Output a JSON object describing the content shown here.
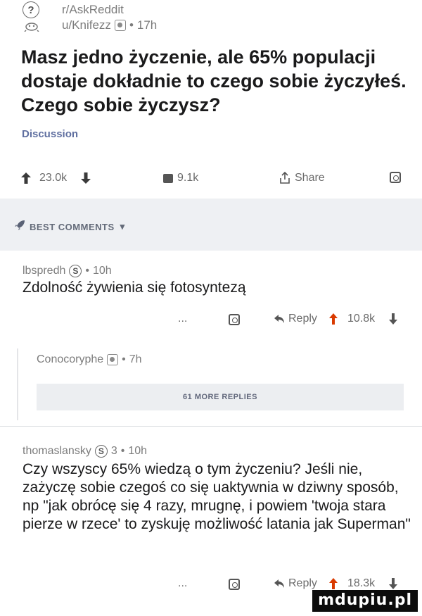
{
  "post": {
    "subreddit": "r/AskReddit",
    "author": "u/Knifezz",
    "age": "17h",
    "title": "Masz jedno życzenie, ale 65% populacji dostaje dokładnie to czego sobie życzyłeś. Czego sobie życzysz?",
    "flair": "Discussion",
    "upvotes": "23.0k",
    "comments": "9.1k",
    "share_label": "Share"
  },
  "best_comments_label": "BEST COMMENTS",
  "comments": [
    {
      "author": "lbspredh",
      "age": "10h",
      "body": "Zdolność żywienia się fotosyntezą",
      "reply_label": "Reply",
      "score": "10.8k"
    },
    {
      "author": "Conocoryphe",
      "age": "7h"
    },
    {
      "author": "thomaslansky",
      "badge_count": "3",
      "age": "10h",
      "body": "Czy wszyscy 65% wiedzą o tym życzeniu? Jeśli nie, zażyczę sobie czegoś co się uaktywnia w dziwny sposób, np \"jak obrócę się 4 razy, mrugnę, i powiem 'twoja stara pierze w rzece' to zyskuję możliwość latania jak Superman\"",
      "reply_label": "Reply",
      "score": "18.3k"
    }
  ],
  "more_replies_label": "61 MORE REPLIES",
  "ellipsis": "...",
  "watermark": "mdupiu.pl",
  "colors": {
    "upvote": "#d93a00",
    "text": "#1a1a1b",
    "muted": "#7c7c7c"
  }
}
